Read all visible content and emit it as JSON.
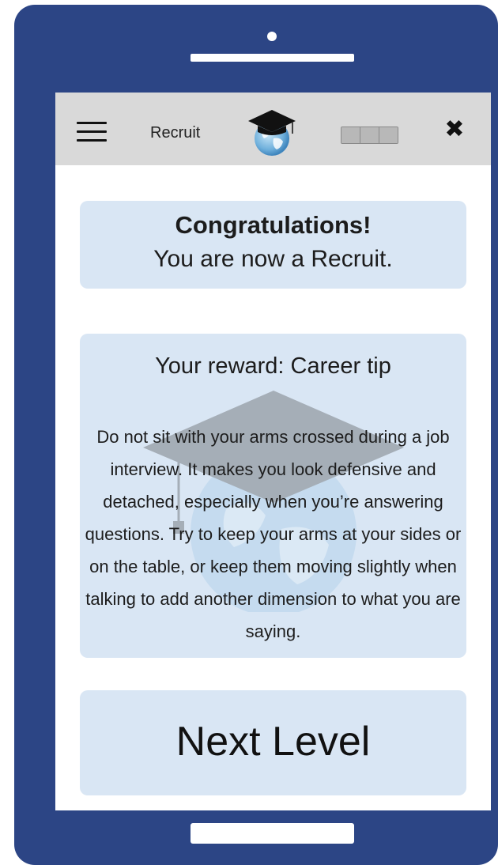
{
  "header": {
    "level": "Recruit",
    "menu_icon": "hamburger-menu-icon",
    "logo_icon": "graduation-cap-globe-icon",
    "close_icon": "close-icon",
    "close_glyph": "✖",
    "progress_segments": 3
  },
  "congrats": {
    "title": "Congratulations!",
    "subtitle": "You are now a Recruit."
  },
  "reward": {
    "title": "Your reward: Career tip",
    "body": "Do not sit with your arms crossed during a job interview. It makes you look defensive and detached, especially when you’re answering questions. Try to keep your arms at your sides or on the table, or keep them moving slightly when talking to add another dimension to what you are saying."
  },
  "actions": {
    "next_label": "Next Level"
  },
  "colors": {
    "phone_body": "#2c4585",
    "header_bar": "#d9d9d9",
    "card_bg": "#d9e6f4"
  }
}
